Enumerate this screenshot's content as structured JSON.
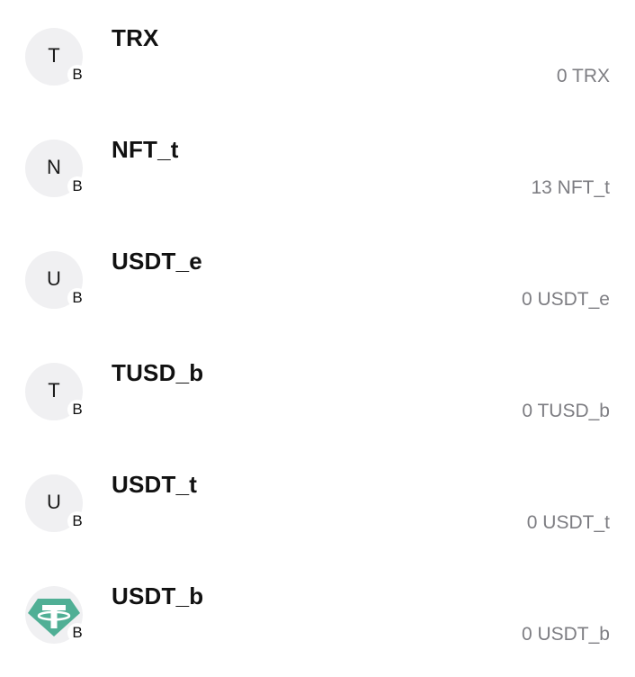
{
  "tokens": [
    {
      "avatar_letter": "T",
      "chain_badge": "B",
      "name": "TRX",
      "balance": "0 TRX",
      "icon": "letter-avatar"
    },
    {
      "avatar_letter": "N",
      "chain_badge": "B",
      "name": "NFT_t",
      "balance": "13 NFT_t",
      "icon": "letter-avatar"
    },
    {
      "avatar_letter": "U",
      "chain_badge": "B",
      "name": "USDT_e",
      "balance": "0 USDT_e",
      "icon": "letter-avatar"
    },
    {
      "avatar_letter": "T",
      "chain_badge": "B",
      "name": "TUSD_b",
      "balance": "0 TUSD_b",
      "icon": "letter-avatar"
    },
    {
      "avatar_letter": "U",
      "chain_badge": "B",
      "name": "USDT_t",
      "balance": "0 USDT_t",
      "icon": "letter-avatar"
    },
    {
      "avatar_letter": "",
      "chain_badge": "B",
      "name": "USDT_b",
      "balance": "0 USDT_b",
      "icon": "tether-logo-icon"
    }
  ],
  "colors": {
    "avatar_bg": "#f0f0f2",
    "balance_text": "#7d7d82",
    "tether_green": "#50af95"
  }
}
